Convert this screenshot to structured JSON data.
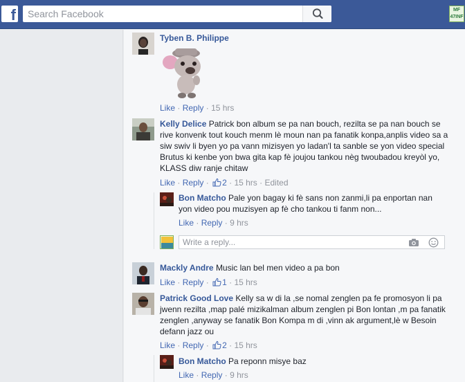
{
  "header": {
    "logo": "f",
    "search_placeholder": "Search Facebook",
    "user_badge_line1": "MF",
    "user_badge_line2": "47INF"
  },
  "comments": [
    {
      "author": "Tyben B. Philippe",
      "text": "",
      "sticker": "bulldog-sticker",
      "like": "Like",
      "reply": "Reply",
      "time": "15 hrs"
    },
    {
      "author": "Kelly Delice",
      "text": "Patrick bon album se pa nan bouch, rezilta se pa nan bouch se rive konvenk tout kouch menm lè moun nan pa fanatik konpa,anplis video sa a siw swiv li byen yo pa vann mizisyen yo ladan'l ta sanble se yon video special Brutus ki kenbe yon bwa gita kap fè joujou tankou nèg twoubadou kreyòl yo, KLASS diw ranje chitaw",
      "like": "Like",
      "reply": "Reply",
      "likes_count": "2",
      "time": "15 hrs",
      "edited": "Edited"
    },
    {
      "author": "Bon Matcho",
      "text": "Pale yon bagay ki fè sans non zanmi,li pa enportan nan yon video pou muzisyen ap fè cho tankou ti fanm non...",
      "like": "Like",
      "reply": "Reply",
      "time": "9 hrs"
    },
    {
      "author": "Mackly Andre",
      "text": "Music lan bel men video a pa bon",
      "like": "Like",
      "reply": "Reply",
      "likes_count": "1",
      "time": "15 hrs"
    },
    {
      "author": "Patrick Good Love",
      "text": "Kelly sa w di la ,se nomal zenglen pa fe promosyon li pa jwenn rezilta ,map palé mizikalman album zenglen pi Bon lontan ,m pa fanatik zenglen ,anyway se fanatik Bon Kompa m di ,vinn ak argument,lè w Besoin defann jazz ou",
      "like": "Like",
      "reply": "Reply",
      "likes_count": "2",
      "time": "15 hrs"
    },
    {
      "author": "Bon Matcho",
      "text": "Pa reponn misye baz",
      "like": "Like",
      "reply": "Reply",
      "time": "9 hrs"
    }
  ],
  "reply_box": {
    "placeholder": "Write a reply..."
  },
  "colors": {
    "header_blue": "#3b5998",
    "link_blue": "#365899",
    "action_blue": "#4267b2",
    "meta_gray": "#90949c"
  }
}
